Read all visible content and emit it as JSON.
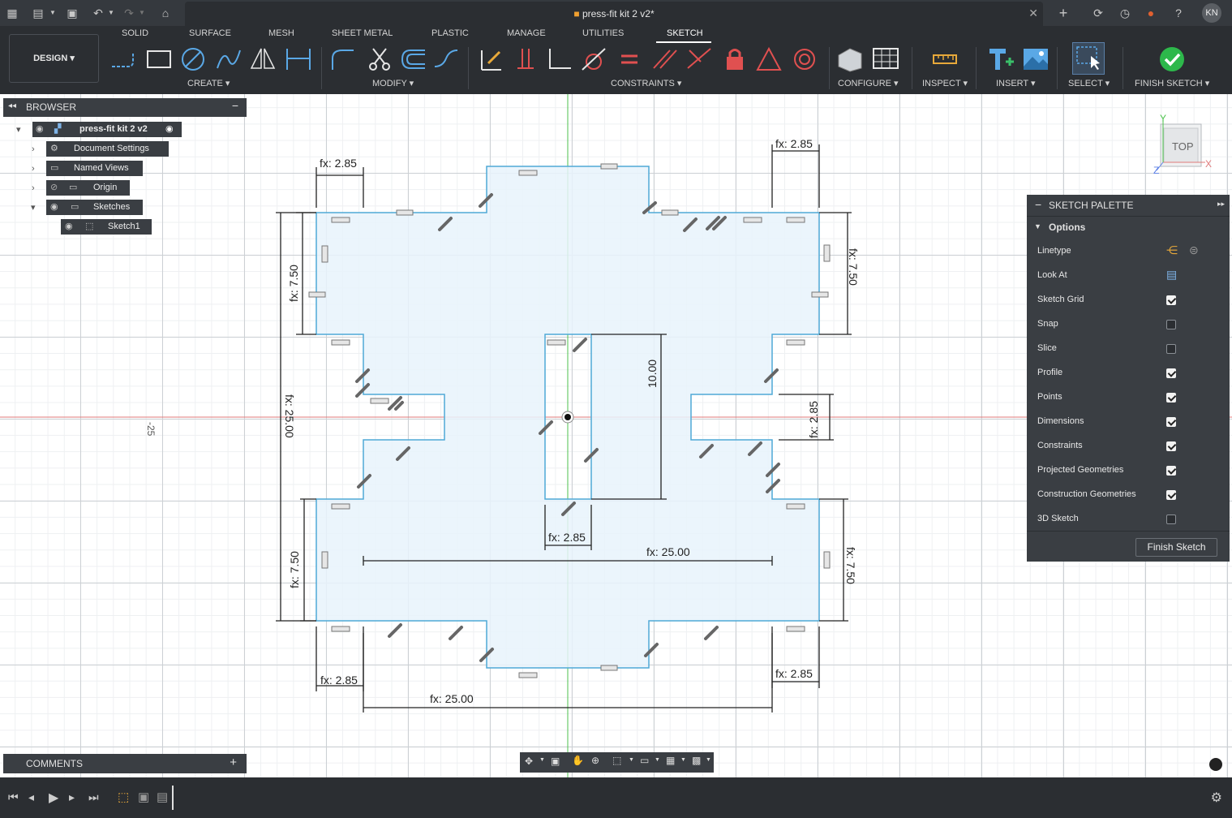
{
  "titlebar": {
    "doc_title": "press-fit kit 2 v2*",
    "avatar_initials": "KN",
    "icons": [
      "apps-grid-icon",
      "file-icon",
      "save-icon",
      "undo-icon",
      "redo-icon",
      "home-icon",
      "close-icon",
      "plus-icon",
      "refresh-icon",
      "clock-icon",
      "bell-icon",
      "help-icon"
    ]
  },
  "toolbar": {
    "workspace": "DESIGN",
    "tabs": [
      "SOLID",
      "SURFACE",
      "MESH",
      "SHEET METAL",
      "PLASTIC",
      "MANAGE",
      "UTILITIES",
      "SKETCH"
    ],
    "active_tab": "SKETCH",
    "groups": {
      "create": "CREATE",
      "modify": "MODIFY",
      "constraints": "CONSTRAINTS",
      "configure": "CONFIGURE",
      "inspect": "INSPECT",
      "insert": "INSERT",
      "select": "SELECT",
      "finish": "FINISH SKETCH"
    },
    "accent_green": "#2db84b"
  },
  "browser": {
    "title": "BROWSER",
    "root": "press-fit kit 2 v2",
    "nodes": [
      "Document Settings",
      "Named Views",
      "Origin",
      "Sketches",
      "Sketch1"
    ]
  },
  "canvas": {
    "axis_label": "-25",
    "viewcube_label": "TOP",
    "axis_x": "X",
    "axis_y": "Y",
    "axis_z": "Z",
    "dimensions": {
      "top_left": "fx: 2.85",
      "top_right": "fx: 2.85",
      "left_upper": "fx: 7.50",
      "right_upper": "fx: 7.50",
      "left_total": "fx: 25.00",
      "center_height": "10.00",
      "right_slot": "fx: 2.85",
      "center_width": "fx: 2.85",
      "center_span": "fx: 25.00",
      "left_lower": "fx: 7.50",
      "right_lower": "fx: 7.50",
      "bottom_left": "fx: 2.85",
      "bottom_right": "fx: 2.85",
      "bottom_span": "fx: 25.00"
    }
  },
  "palette": {
    "title": "SKETCH PALETTE",
    "section": "Options",
    "rows": [
      {
        "label": "Linetype",
        "type": "icons"
      },
      {
        "label": "Look At",
        "type": "icon"
      },
      {
        "label": "Sketch Grid",
        "checked": true
      },
      {
        "label": "Snap",
        "checked": false
      },
      {
        "label": "Slice",
        "checked": false
      },
      {
        "label": "Profile",
        "checked": true
      },
      {
        "label": "Points",
        "checked": true
      },
      {
        "label": "Dimensions",
        "checked": true
      },
      {
        "label": "Constraints",
        "checked": true
      },
      {
        "label": "Projected Geometries",
        "checked": true
      },
      {
        "label": "Construction Geometries",
        "checked": true
      },
      {
        "label": "3D Sketch",
        "checked": false
      }
    ],
    "finish_button": "Finish Sketch"
  },
  "comments": {
    "title": "COMMENTS"
  },
  "colors": {
    "profile_fill": "#e8f3fb",
    "profile_stroke": "#4fa9d6",
    "x_axis": "#e07a7a",
    "y_axis": "#4cc24c",
    "panel_bg": "#3a3e43"
  }
}
